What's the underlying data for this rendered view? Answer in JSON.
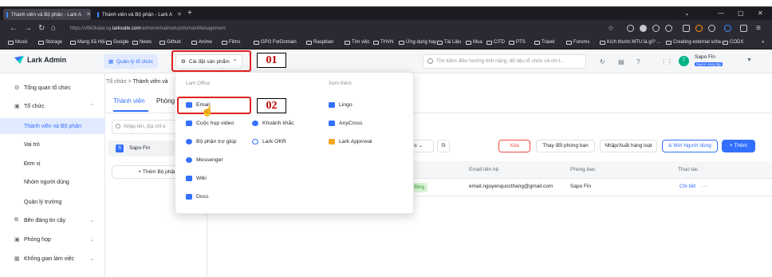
{
  "browser": {
    "tabs": [
      {
        "title": "Thành viên và Bộ phận - Lark A",
        "close": "✕"
      },
      {
        "title": "Thành viên và Bộ phận - Lark A",
        "close": "✕"
      }
    ],
    "new_tab": "+",
    "url_prefix": "https://vftk0kqlat.sg.",
    "url_domain": "larksuite.com",
    "url_path": "/admin/email/setup/domainManagement",
    "window_controls": [
      "⌄",
      "—",
      "▢",
      "✕"
    ],
    "bookmarks": [
      "Music",
      "Storage",
      "Mang Xã Hội",
      "Google",
      "News",
      "Github",
      "Anime",
      "Films",
      "GPO ForDomain",
      "Raspbian",
      "Tìm việc",
      "THVN",
      "Ứng dụng hay",
      "Tài Liệu",
      "Mua",
      "CITD",
      "PTS",
      "Travel",
      "Forums",
      "Kích thước MTU là gì? ...",
      "Creating external sche...",
      "CODX"
    ],
    "bookmarks_more": "»"
  },
  "app": {
    "logo": "Lark Admin",
    "quick_manage": "Quản lý tổ chức",
    "settings_product": "Cài đặt sản phẩm",
    "search_placeholder": "Tìm kiếm điều hướng tính năng, dữ liệu tổ chức và chi t...",
    "user_name": "Sapo Fin",
    "user_tag": "Người sáng lập",
    "avatar_initial": "T"
  },
  "sidebar": [
    {
      "label": "Tổng quan tổ chức",
      "icon": "⚙"
    },
    {
      "label": "Tổ chức",
      "icon": "▣",
      "caret": "⌃"
    },
    {
      "label": "Thành viên và Bộ phận"
    },
    {
      "label": "Vai trò"
    },
    {
      "label": "Đơn vị"
    },
    {
      "label": "Nhóm người dùng"
    },
    {
      "label": "Quản lý trường"
    },
    {
      "label": "Bên đáng tin cậy",
      "icon": "⧉",
      "caret": "⌄"
    },
    {
      "label": "Phòng họp",
      "icon": "▣",
      "caret": "⌄"
    },
    {
      "label": "Không gian làm việc",
      "icon": "▦",
      "caret": "⌄"
    }
  ],
  "main": {
    "breadcrumb_root": "Tổ chức",
    "breadcrumb_sep": ">",
    "breadcrumb_current": "Thành viên và",
    "tab_members": "Thành viên",
    "tab_departments": "Phòng",
    "filter_placeholder": "Nhập tên, địa chỉ e",
    "org_initial": "S",
    "org_name": "Sapo Fin",
    "add_department": "+ Thêm Bộ phận",
    "sort_label": "ốc ⌄",
    "delete": "Xóa",
    "change_department": "Thay đổi phòng ban",
    "import_export": "Nhập/Xuất hàng loạt",
    "add_users": "& Mời Người dùng",
    "add": "+ Thêm",
    "columns": [
      "Email liên hệ",
      "Phòng ban",
      "Thao tác"
    ],
    "row": {
      "status": "đồng",
      "email": "email.nguyenquocthang@gmail.com",
      "department": "Sapo Fin",
      "action": "Chi tiết",
      "more": "···"
    }
  },
  "dropdown": {
    "section_left": "Lark Office",
    "section_right": "Xem thêm",
    "items_left": [
      {
        "label": "Email",
        "color": "#3370ff"
      },
      {
        "label": "Cuộc họp video",
        "color": "#3370ff"
      },
      {
        "label": "Bộ phận trợ giúp",
        "color": "#3370ff"
      },
      {
        "label": "Messenger",
        "color": "#3370ff"
      },
      {
        "label": "Wiki",
        "color": "#3370ff"
      },
      {
        "label": "Docs",
        "color": "#3370ff"
      }
    ],
    "items_mid": [
      {
        "label": "Khoảnh khắc",
        "color": "#3370ff"
      },
      {
        "label": "Lark OKR",
        "color": "#3370ff"
      }
    ],
    "items_right": [
      {
        "label": "Lingo",
        "color": "#3370ff"
      },
      {
        "label": "AnyCross",
        "color": "#3370ff"
      },
      {
        "label": "Lark Approval",
        "color": "#f5a623"
      }
    ]
  },
  "annotations": {
    "step1": "01",
    "step2": "02"
  }
}
